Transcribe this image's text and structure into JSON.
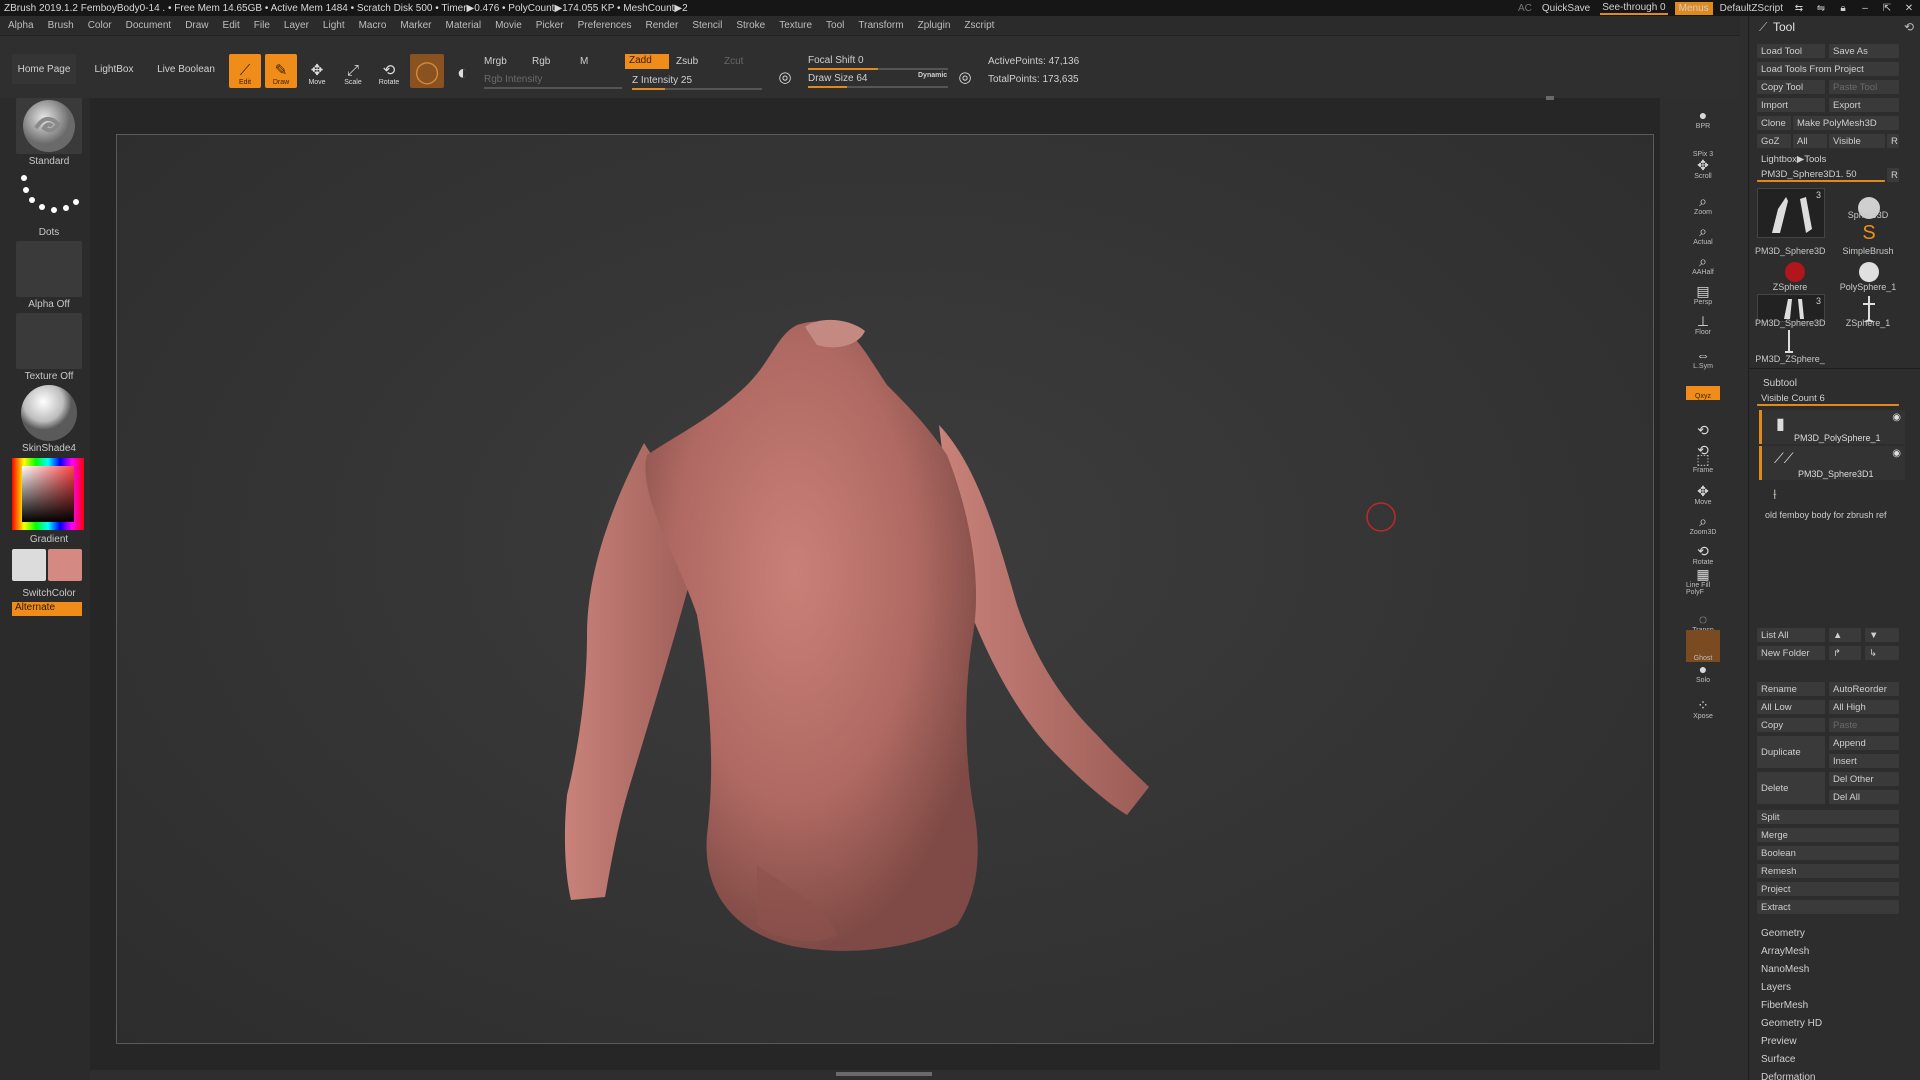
{
  "titlebar": {
    "title": "ZBrush 2019.1.2  FemboyBody0-14  .  • Free Mem 14.65GB • Active Mem 1484 • Scratch Disk 500 • Timer▶0.476 • PolyCount▶174.055 KP • MeshCount▶2",
    "ac": "AC",
    "quicksave": "QuickSave",
    "see_through": "See-through  0",
    "menus": "Menus",
    "script": "DefaultZScript"
  },
  "menus": [
    "Alpha",
    "Brush",
    "Color",
    "Document",
    "Draw",
    "Edit",
    "File",
    "Layer",
    "Light",
    "Macro",
    "Marker",
    "Material",
    "Movie",
    "Picker",
    "Preferences",
    "Render",
    "Stencil",
    "Stroke",
    "Texture",
    "Tool",
    "Transform",
    "Zplugin",
    "Zscript"
  ],
  "toolbar": {
    "home": "Home Page",
    "lightbox": "LightBox",
    "live_boolean": "Live Boolean",
    "edit": "Edit",
    "draw": "Draw",
    "move": "Move",
    "scale": "Scale",
    "rotate": "Rotate",
    "mrgb": "Mrgb",
    "rgb": "Rgb",
    "m": "M",
    "rgb_intensity": "Rgb Intensity",
    "zadd": "Zadd",
    "zsub": "Zsub",
    "zcut": "Zcut",
    "z_intensity": "Z Intensity 25",
    "focal_shift": "Focal Shift 0",
    "draw_size": "Draw Size 64",
    "dynamic": "Dynamic",
    "active_points": "ActivePoints: 47,136",
    "total_points": "TotalPoints: 173,635",
    "z_intensity_value": 25,
    "focal_value": 0
  },
  "leftshelf": {
    "standard": "Standard",
    "dots": "Dots",
    "alpha": "Alpha Off",
    "texture": "Texture Off",
    "material": "SkinShade4",
    "gradient": "Gradient",
    "switch": "SwitchColor",
    "alternate": "Alternate"
  },
  "rightshelf": [
    "BPR",
    "SPix 3",
    "Scroll",
    "Zoom",
    "Actual",
    "AAHalf",
    "Persp",
    "Floor",
    "L.Sym",
    "",
    "Qxyz",
    "",
    "",
    "Frame",
    "Move",
    "Zoom3D",
    "Rotate",
    "Line Fill PolyF",
    "Transp",
    "Ghost",
    "Solo",
    "Xpose"
  ],
  "toolpanel": {
    "title": "Tool",
    "load": "Load Tool",
    "save": "Save As",
    "load_project": "Load Tools From Project",
    "copy": "Copy Tool",
    "paste": "Paste Tool",
    "import": "Import",
    "export": "Export",
    "clone": "Clone",
    "make_poly": "Make PolyMesh3D",
    "goz": "GoZ",
    "all": "All",
    "visible": "Visible",
    "r": "R",
    "lightbox_tools": "Lightbox▶Tools",
    "current": "PM3D_Sphere3D1. 50",
    "r2": "R",
    "tools": [
      "PM3D_Sphere3D",
      "Sphere3D",
      "SimpleBrush",
      "ZSphere",
      "PolySphere_1",
      "PM3D_Sphere3D",
      "ZSphere_1",
      "PM3D_ZSphere_"
    ],
    "badge1": "3",
    "badge2": "3",
    "subtool": "Subtool",
    "visible_count": "Visible Count 6",
    "subtools": [
      "PM3D_PolySphere_1",
      "PM3D_Sphere3D1",
      "old femboy body for zbrush ref"
    ],
    "list_all": "List All",
    "new_folder": "New Folder",
    "rename": "Rename",
    "autoreorder": "AutoReorder",
    "all_low": "All Low",
    "all_high": "All High",
    "copy2": "Copy",
    "paste2": "Paste",
    "duplicate": "Duplicate",
    "append": "Append",
    "insert": "Insert",
    "delete": "Delete",
    "del_other": "Del Other",
    "del_all": "Del All",
    "split": "Split",
    "merge": "Merge",
    "boolean": "Boolean",
    "remesh": "Remesh",
    "project": "Project",
    "extract": "Extract",
    "sections": [
      "Geometry",
      "ArrayMesh",
      "NanoMesh",
      "Layers",
      "FiberMesh",
      "Geometry HD",
      "Preview",
      "Surface",
      "Deformation"
    ]
  },
  "colors": {
    "accent": "#f08d1a",
    "skin": "#b9736b"
  }
}
